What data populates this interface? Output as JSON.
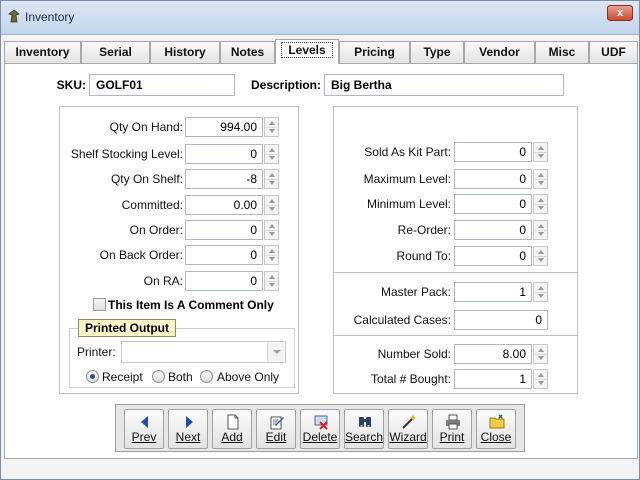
{
  "window": {
    "title": "Inventory",
    "close_glyph": "x"
  },
  "tabs": [
    {
      "label": "Inventory",
      "active": false
    },
    {
      "label": "Serial",
      "active": false
    },
    {
      "label": "History",
      "active": false
    },
    {
      "label": "Notes",
      "active": false
    },
    {
      "label": "Levels",
      "active": true
    },
    {
      "label": "Pricing",
      "active": false
    },
    {
      "label": "Type",
      "active": false
    },
    {
      "label": "Vendor",
      "active": false
    },
    {
      "label": "Misc",
      "active": false
    },
    {
      "label": "UDF",
      "active": false
    }
  ],
  "header": {
    "sku_label": "SKU:",
    "sku_value": "GOLF01",
    "desc_label": "Description:",
    "desc_value": "Big Bertha"
  },
  "left_fields": [
    {
      "label": "Qty On Hand:",
      "value": "994.00",
      "spin": true
    },
    {
      "label": "Shelf Stocking Level:",
      "value": "0",
      "spin": true
    },
    {
      "label": "Qty On Shelf:",
      "value": "-8",
      "spin": true
    },
    {
      "label": "Committed:",
      "value": "0.00",
      "spin": true
    },
    {
      "label": "On Order:",
      "value": "0",
      "spin": true
    },
    {
      "label": "On Back Order:",
      "value": "0",
      "spin": true
    },
    {
      "label": "On RA:",
      "value": "0",
      "spin": true
    }
  ],
  "comment_checkbox": {
    "label": "This Item Is A Comment Only",
    "checked": false
  },
  "printed_output": {
    "legend": "Printed Output",
    "printer_label": "Printer:",
    "printer_value": "",
    "options": [
      {
        "label": "Receipt",
        "selected": true
      },
      {
        "label": "Both",
        "selected": false
      },
      {
        "label": "Above Only",
        "selected": false
      }
    ]
  },
  "right_fields": [
    {
      "label": "Sold As Kit Part:",
      "value": "0",
      "spin": true
    },
    {
      "label": "Maximum Level:",
      "value": "0",
      "spin": true
    },
    {
      "label": "Minimum Level:",
      "value": "0",
      "spin": true
    },
    {
      "label": "Re-Order:",
      "value": "0",
      "spin": true
    },
    {
      "label": "Round To:",
      "value": "0",
      "spin": true
    }
  ],
  "pack_fields": [
    {
      "label": "Master Pack:",
      "value": "1",
      "spin": true
    },
    {
      "label": "Calculated Cases:",
      "value": "0",
      "spin": false
    }
  ],
  "sales_fields": [
    {
      "label": "Number Sold:",
      "value": "8.00",
      "spin": true
    },
    {
      "label": "Total # Bought:",
      "value": "1",
      "spin": true
    }
  ],
  "toolbar": [
    {
      "label": "Prev",
      "icon": "arrow-left-icon"
    },
    {
      "label": "Next",
      "icon": "arrow-right-icon"
    },
    {
      "label": "Add",
      "icon": "new-document-icon"
    },
    {
      "label": "Edit",
      "icon": "edit-icon"
    },
    {
      "label": "Delete",
      "icon": "delete-icon"
    },
    {
      "label": "Search",
      "icon": "binoculars-icon"
    },
    {
      "label": "Wizard",
      "icon": "wand-icon"
    },
    {
      "label": "Print",
      "icon": "printer-icon"
    },
    {
      "label": "Close",
      "icon": "close-folder-icon"
    }
  ],
  "colors": {
    "accent": "#1f4fa8",
    "legend_bg": "#fbf6c8",
    "close_red": "#c74b33"
  }
}
